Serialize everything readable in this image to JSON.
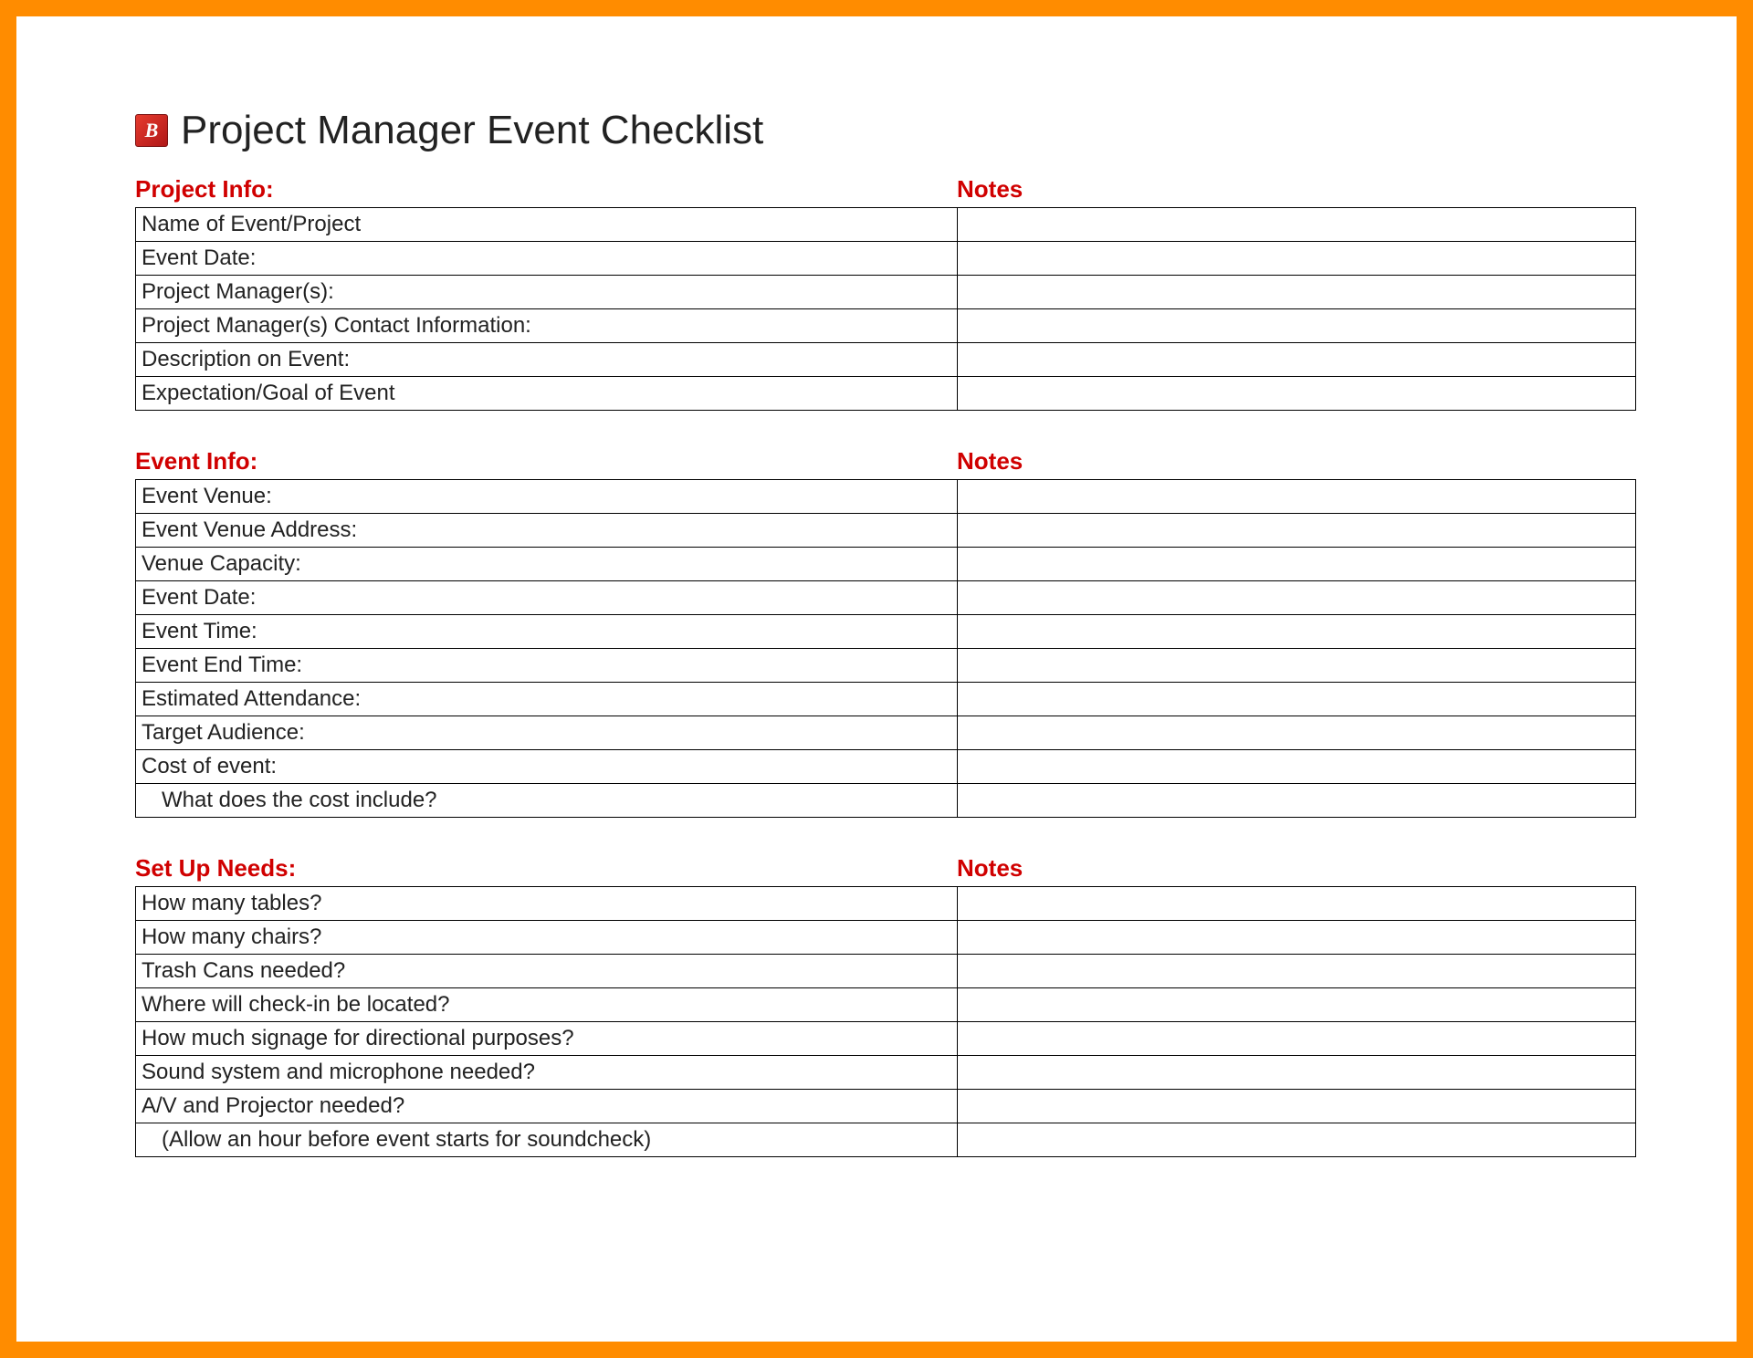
{
  "title": "Project Manager Event Checklist",
  "icon_glyph": "B",
  "sections": {
    "project_info": {
      "heading": "Project Info:",
      "notes_heading": "Notes",
      "rows": [
        {
          "label": "Name of Event/Project",
          "notes": "",
          "indent": false
        },
        {
          "label": "Event Date:",
          "notes": "",
          "indent": false
        },
        {
          "label": "Project Manager(s):",
          "notes": "",
          "indent": false
        },
        {
          "label": "Project Manager(s) Contact Information:",
          "notes": "",
          "indent": false
        },
        {
          "label": "Description on Event:",
          "notes": "",
          "indent": false
        },
        {
          "label": "Expectation/Goal of Event",
          "notes": "",
          "indent": false
        }
      ]
    },
    "event_info": {
      "heading": "Event Info:",
      "notes_heading": "Notes",
      "rows": [
        {
          "label": "Event Venue:",
          "notes": "",
          "indent": false
        },
        {
          "label": "Event Venue Address:",
          "notes": "",
          "indent": false
        },
        {
          "label": "Venue Capacity:",
          "notes": "",
          "indent": false
        },
        {
          "label": "Event Date:",
          "notes": "",
          "indent": false
        },
        {
          "label": "Event Time:",
          "notes": "",
          "indent": false
        },
        {
          "label": "Event End Time:",
          "notes": "",
          "indent": false
        },
        {
          "label": "Estimated Attendance:",
          "notes": "",
          "indent": false
        },
        {
          "label": "Target Audience:",
          "notes": "",
          "indent": false
        },
        {
          "label": "Cost of event:",
          "notes": "",
          "indent": false
        },
        {
          "label": "What does the cost include?",
          "notes": "",
          "indent": true
        }
      ]
    },
    "set_up_needs": {
      "heading": "Set Up Needs:",
      "notes_heading": "Notes",
      "rows": [
        {
          "label": "How many tables?",
          "notes": "",
          "indent": false
        },
        {
          "label": "How many chairs?",
          "notes": "",
          "indent": false
        },
        {
          "label": "Trash Cans needed?",
          "notes": "",
          "indent": false
        },
        {
          "label": "Where will check-in be located?",
          "notes": "",
          "indent": false
        },
        {
          "label": "How much signage for directional purposes?",
          "notes": "",
          "indent": false
        },
        {
          "label": "Sound system and microphone needed?",
          "notes": "",
          "indent": false
        },
        {
          "label": "A/V and Projector needed?",
          "notes": "",
          "indent": false
        },
        {
          "label": "(Allow an hour before event starts for soundcheck)",
          "notes": "",
          "indent": true
        }
      ]
    }
  }
}
